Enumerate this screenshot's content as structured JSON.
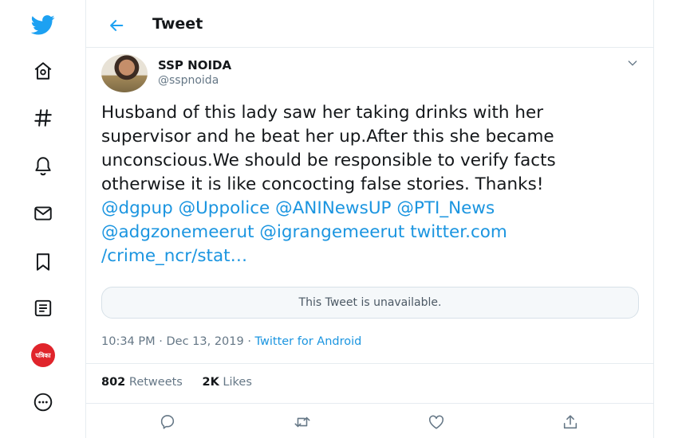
{
  "colors": {
    "accent": "#1da1f2",
    "link": "#1b95e0",
    "muted": "#657786",
    "text": "#14171a"
  },
  "sidebar": {
    "items": [
      {
        "icon": "twitter-bird-icon"
      },
      {
        "icon": "home-icon"
      },
      {
        "icon": "hashtag-explore-icon"
      },
      {
        "icon": "bell-notifications-icon"
      },
      {
        "icon": "mail-messages-icon"
      },
      {
        "icon": "bookmark-icon"
      },
      {
        "icon": "list-icon"
      },
      {
        "icon": "profile-avatar-icon",
        "label": "पत्रिका"
      },
      {
        "icon": "more-options-icon"
      }
    ]
  },
  "header": {
    "title": "Tweet",
    "back_icon": "arrow-left-icon"
  },
  "tweet": {
    "author_name": "SSP NOIDA",
    "author_handle": "@sspnoida",
    "text_lines": [
      "Husband of this lady saw her taking drinks with her",
      "supervisor and he beat her up.After this she became",
      "unconscious.We should be responsible to verify facts",
      "otherwise it is like concocting false stories. Thanks!"
    ],
    "mentions_line1": [
      "@dgpup",
      "@Uppolice",
      "@ANINewsUP",
      "@PTI_News"
    ],
    "mentions_line2": [
      "@adgzonemeerut",
      "@igrangemeerut",
      "twitter.com"
    ],
    "link_tail": "/crime_ncr/stat…",
    "quoted_unavailable": "This Tweet is unavailable.",
    "timestamp": "10:34 PM · Dec 13, 2019",
    "separator": "·",
    "source": "Twitter for Android",
    "retweets_count": "802",
    "retweets_label": "Retweets",
    "likes_count": "2K",
    "likes_label": "Likes"
  },
  "actions": [
    "reply-icon",
    "retweet-icon",
    "like-icon",
    "share-icon"
  ]
}
